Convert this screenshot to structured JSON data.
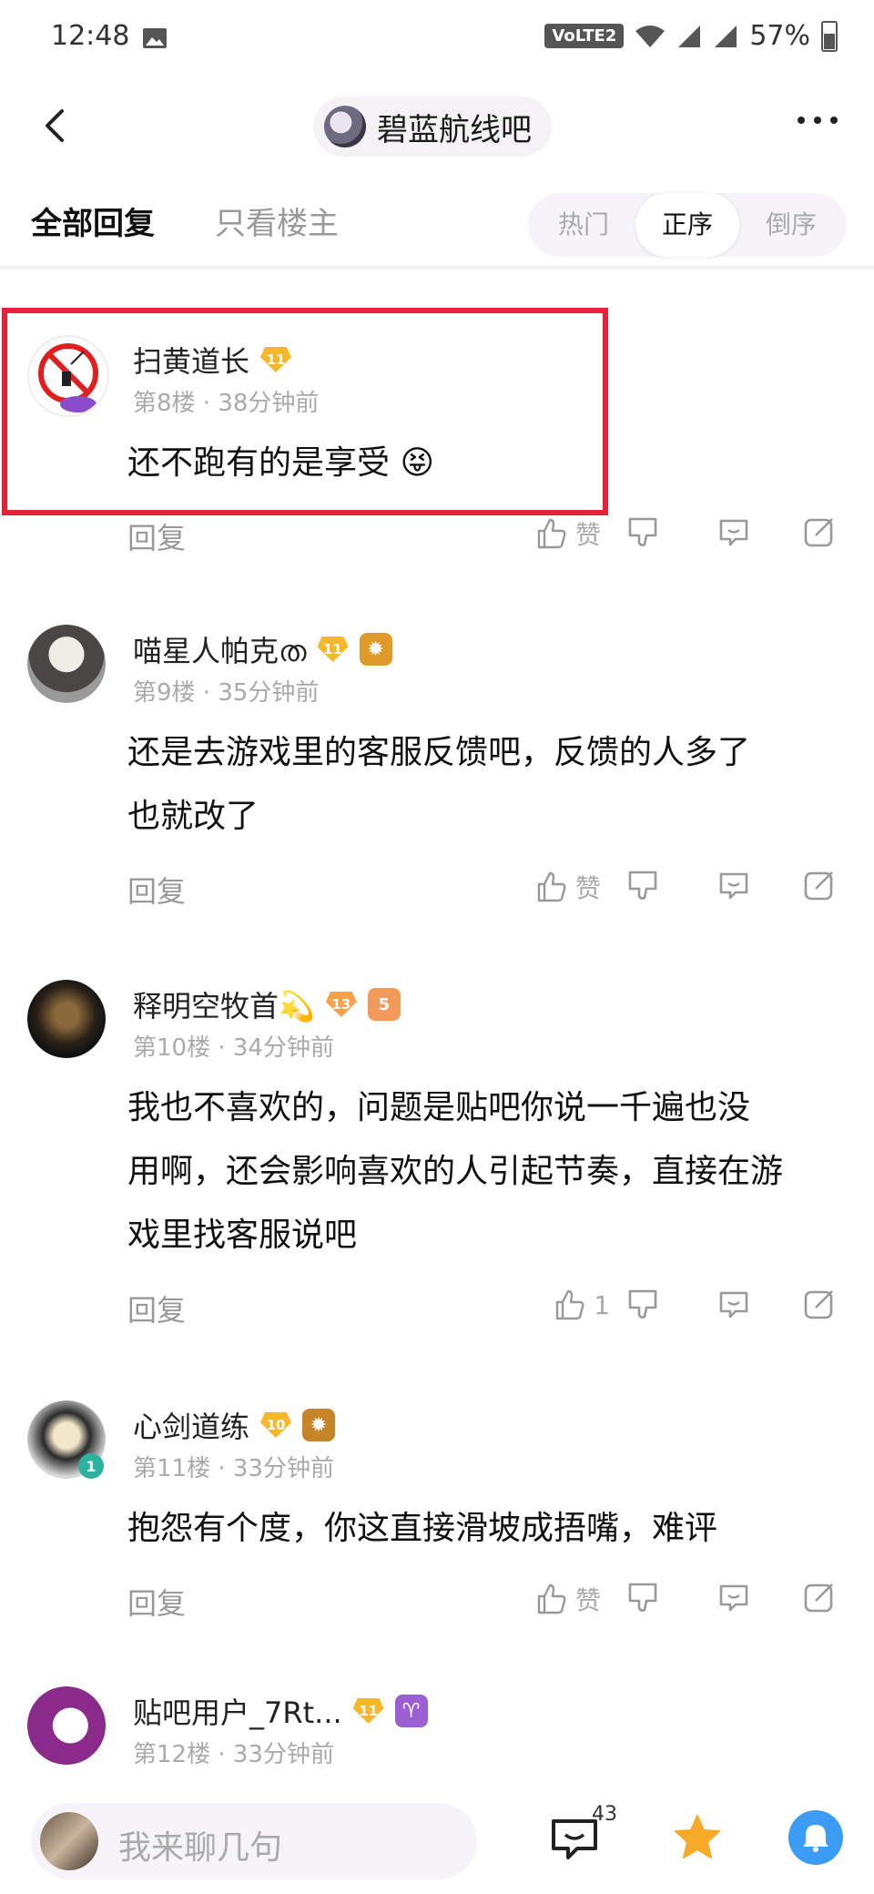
{
  "status": {
    "time": "12:48",
    "volte": "VoLTE2",
    "battery": "57%"
  },
  "header": {
    "forum_name": "碧蓝航线吧"
  },
  "tabs": {
    "all": "全部回复",
    "op_only": "只看楼主",
    "sort": [
      "热门",
      "正序",
      "倒序"
    ],
    "active_sort": "正序"
  },
  "posts": [
    {
      "username": "扫黄道长",
      "level": "11",
      "floor": "第8楼",
      "time": "38分钟前",
      "content": [
        "还不跑有的是享受 😝"
      ],
      "reply": "回复",
      "like": "赞",
      "highlighted": true
    },
    {
      "username": "喵星人帕克ത",
      "level": "11",
      "floor": "第9楼",
      "time": "35分钟前",
      "content": [
        "还是去游戏里的客服反馈吧，反馈的人多了",
        "也就改了"
      ],
      "reply": "回复",
      "like": "赞"
    },
    {
      "username": "释明空牧首💫",
      "level": "13",
      "floor": "第10楼",
      "time": "34分钟前",
      "content": [
        "我也不喜欢的，问题是贴吧你说一千遍也没",
        "用啊，还会影响喜欢的人引起节奏，直接在游",
        "戏里找客服说吧"
      ],
      "reply": "回复",
      "like": "1",
      "badge_number": "5"
    },
    {
      "username": "心剑道练",
      "level": "10",
      "floor": "第11楼",
      "time": "33分钟前",
      "content": [
        "抱怨有个度，你这直接滑坡成捂嘴，难评"
      ],
      "reply": "回复",
      "like": "赞",
      "avatar_badge": "1"
    },
    {
      "username": "贴吧用户_7Rt...",
      "level": "11",
      "floor": "第12楼",
      "time": "33分钟前",
      "zodiac": "♈"
    }
  ],
  "bottom": {
    "placeholder": "我来聊几句",
    "comment_count": "43"
  },
  "colors": {
    "highlight": "#e8213a",
    "level_gold": "#f6b72b",
    "bell": "#3a9cf5",
    "star": "#f7a928"
  }
}
